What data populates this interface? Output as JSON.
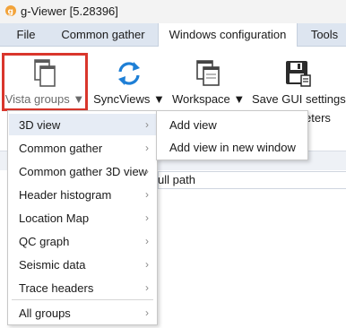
{
  "window": {
    "title": "g-Viewer [5.28396]",
    "app_icon": "g-viewer-logo-icon"
  },
  "tabs": [
    {
      "label": "File",
      "active": false
    },
    {
      "label": "Common gather",
      "active": false
    },
    {
      "label": "Windows configuration",
      "active": true
    },
    {
      "label": "Tools",
      "active": false
    }
  ],
  "ribbon": {
    "buttons": [
      {
        "label": "Vista groups ▼",
        "icon": "stacked-windows-icon",
        "highlighted": true
      },
      {
        "label": "SyncViews ▼",
        "icon": "sync-arrows-icon"
      },
      {
        "label": "Workspace ▼",
        "icon": "workspace-windows-icon"
      },
      {
        "label": "Save GUI settings",
        "icon": "save-floppy-icon"
      }
    ],
    "highlight_color": "#d9362c"
  },
  "background": {
    "partial_label": "eters",
    "column_header": "ull path"
  },
  "dropdown": {
    "items": [
      {
        "label": "3D view",
        "chevron": "›",
        "hover": true
      },
      {
        "label": "Common gather",
        "chevron": "›"
      },
      {
        "label": "Common gather 3D view",
        "chevron": "›"
      },
      {
        "label": "Header histogram",
        "chevron": "›"
      },
      {
        "label": "Location Map",
        "chevron": "›"
      },
      {
        "label": "QC graph",
        "chevron": "›"
      },
      {
        "label": "Seismic data",
        "chevron": "›"
      },
      {
        "label": "Trace headers",
        "chevron": "›"
      },
      {
        "label": "All groups",
        "chevron": "›"
      }
    ]
  },
  "submenu": {
    "items": [
      {
        "label": "Add view"
      },
      {
        "label": "Add view in new window"
      }
    ]
  },
  "colors": {
    "tab_strip": "#dde5f0",
    "menu_hover": "#e6ecf5",
    "accent_blue": "#1e7fd6"
  }
}
